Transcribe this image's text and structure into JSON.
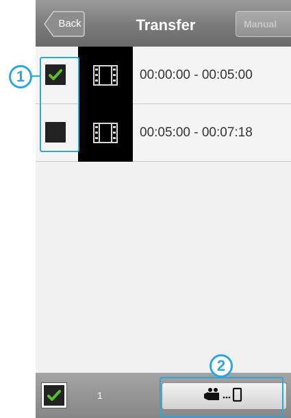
{
  "header": {
    "back_label": "Back",
    "title": "Transfer",
    "manual_label": "Manual"
  },
  "clips": [
    {
      "time_range": "00:00:00 - 00:05:00",
      "checked": true,
      "icon": "film-icon"
    },
    {
      "time_range": "00:05:00 - 00:07:18",
      "checked": false,
      "icon": "film-icon"
    }
  ],
  "footer": {
    "select_all_checked": true,
    "selected_count": "1",
    "transfer_icon": "camera-to-phone-icon"
  },
  "callouts": {
    "one": "1",
    "two": "2"
  },
  "colors": {
    "header_top": "#9a9a9a",
    "header_bottom": "#6a6a6a",
    "check_green": "#5bbf2a",
    "callout_blue": "#2aa7df"
  }
}
